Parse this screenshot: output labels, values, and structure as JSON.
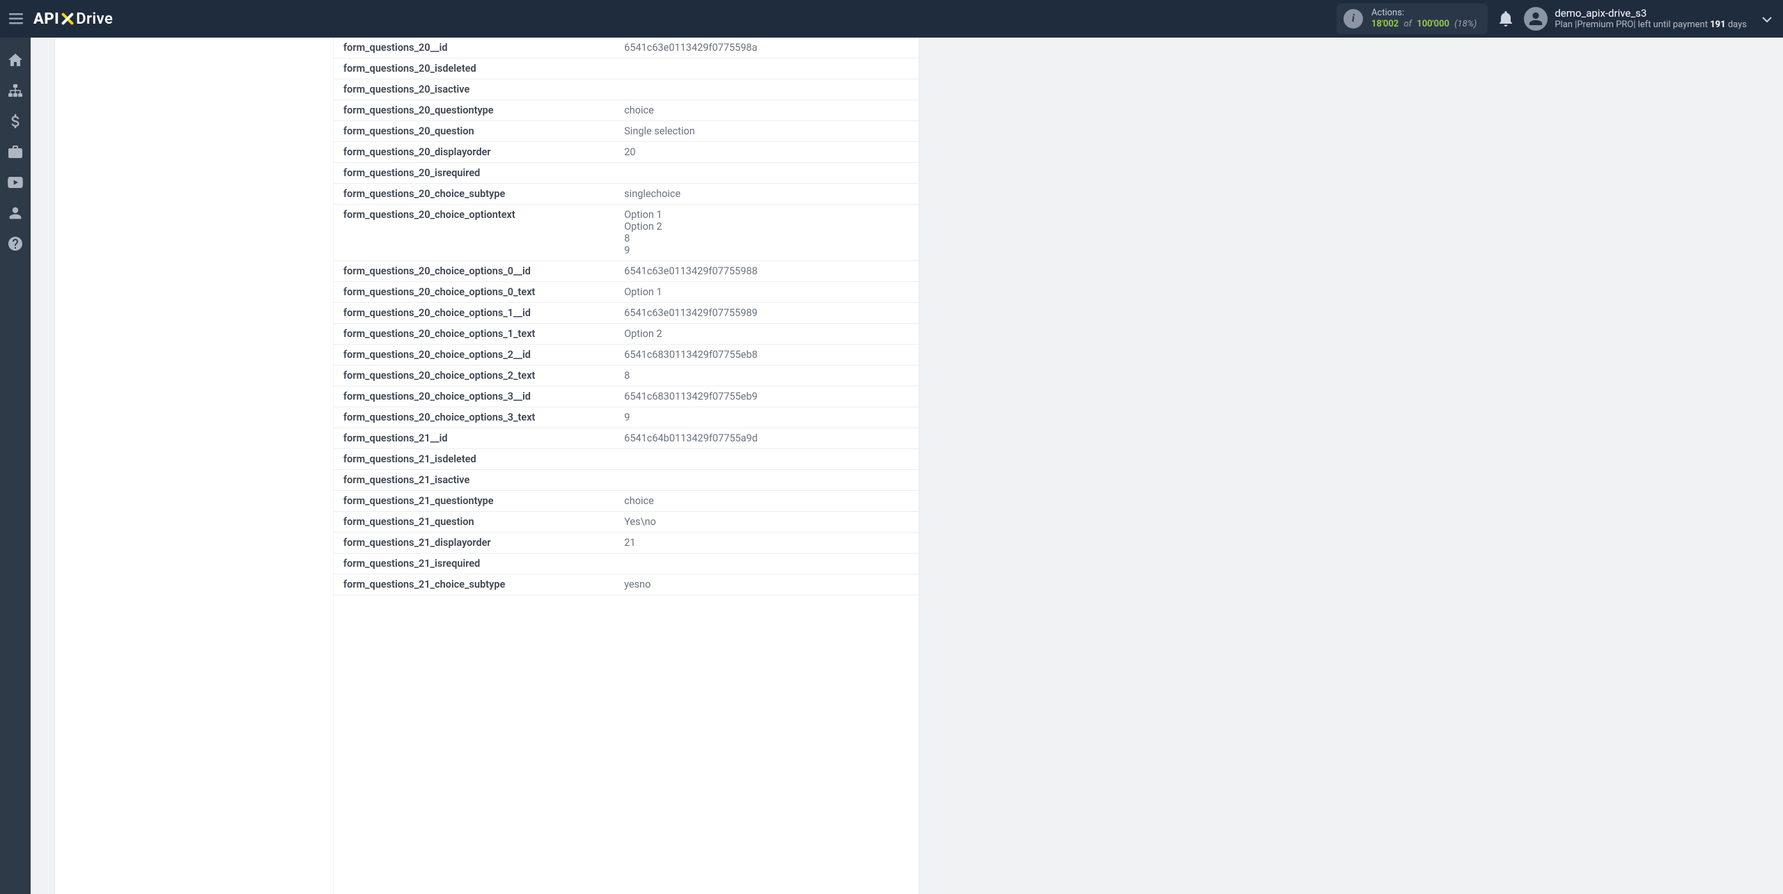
{
  "header": {
    "logo": {
      "part1": "API",
      "part2": "Drive"
    },
    "actions": {
      "label": "Actions:",
      "used": "18'002",
      "of": "of",
      "total": "100'000",
      "percent": "(18%)"
    },
    "user": {
      "name": "demo_apix-drive_s3",
      "plan_prefix": "Plan |Premium PRO| left until payment ",
      "days": "191",
      "plan_suffix": " days"
    }
  },
  "sidebar": {
    "items": [
      {
        "name": "home-icon"
      },
      {
        "name": "sitemap-icon"
      },
      {
        "name": "dollar-icon"
      },
      {
        "name": "briefcase-icon"
      },
      {
        "name": "youtube-icon"
      },
      {
        "name": "user-icon"
      },
      {
        "name": "help-icon"
      }
    ]
  },
  "rows": [
    {
      "key": "form_questions_20__id",
      "val": "6541c63e0113429f0775598a"
    },
    {
      "key": "form_questions_20_isdeleted",
      "val": ""
    },
    {
      "key": "form_questions_20_isactive",
      "val": ""
    },
    {
      "key": "form_questions_20_questiontype",
      "val": "choice"
    },
    {
      "key": "form_questions_20_question",
      "val": "Single selection"
    },
    {
      "key": "form_questions_20_displayorder",
      "val": "20"
    },
    {
      "key": "form_questions_20_isrequired",
      "val": ""
    },
    {
      "key": "form_questions_20_choice_subtype",
      "val": "singlechoice"
    },
    {
      "key": "form_questions_20_choice_optiontext",
      "val": "Option 1\nOption 2\n8\n9"
    },
    {
      "key": "form_questions_20_choice_options_0__id",
      "val": "6541c63e0113429f07755988"
    },
    {
      "key": "form_questions_20_choice_options_0_text",
      "val": "Option 1"
    },
    {
      "key": "form_questions_20_choice_options_1__id",
      "val": "6541c63e0113429f07755989"
    },
    {
      "key": "form_questions_20_choice_options_1_text",
      "val": "Option 2"
    },
    {
      "key": "form_questions_20_choice_options_2__id",
      "val": "6541c6830113429f07755eb8"
    },
    {
      "key": "form_questions_20_choice_options_2_text",
      "val": "8"
    },
    {
      "key": "form_questions_20_choice_options_3__id",
      "val": "6541c6830113429f07755eb9"
    },
    {
      "key": "form_questions_20_choice_options_3_text",
      "val": "9"
    },
    {
      "key": "form_questions_21__id",
      "val": "6541c64b0113429f07755a9d"
    },
    {
      "key": "form_questions_21_isdeleted",
      "val": ""
    },
    {
      "key": "form_questions_21_isactive",
      "val": ""
    },
    {
      "key": "form_questions_21_questiontype",
      "val": "choice"
    },
    {
      "key": "form_questions_21_question",
      "val": "Yes\\no"
    },
    {
      "key": "form_questions_21_displayorder",
      "val": "21"
    },
    {
      "key": "form_questions_21_isrequired",
      "val": ""
    },
    {
      "key": "form_questions_21_choice_subtype",
      "val": "yesno"
    }
  ]
}
